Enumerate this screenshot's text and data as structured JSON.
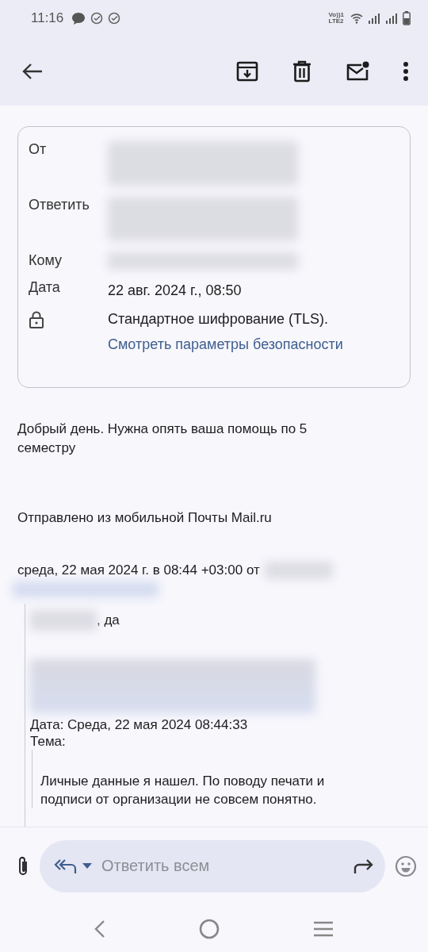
{
  "status_bar": {
    "time": "11:16",
    "volte_top": "Vo))1",
    "volte_bottom": "LTE2"
  },
  "header": {
    "rows": [
      {
        "label": "От",
        "kind": "blurred_block"
      },
      {
        "label": "Ответить",
        "kind": "blurred_block"
      },
      {
        "label": "Кому",
        "kind": "blurred_line"
      },
      {
        "label": "Дата",
        "kind": "text",
        "value": "22 авг. 2024 г., 08:50"
      }
    ],
    "security": {
      "text": "Стандартное шифрование (TLS).",
      "link": "Смотреть параметры безопасности"
    }
  },
  "body": [
    {
      "kind": "text",
      "text": "Добрый день. Нужна опять ваша помощь по 5 семестру"
    },
    {
      "kind": "text",
      "text": "Отправлено из мобильной Почты Mail.ru"
    },
    {
      "kind": "attribution",
      "text": "среда, 22 мая 2024 г. в 08:44 +03:00 от",
      "blurred": true
    },
    {
      "kind": "blurred_link"
    },
    {
      "kind": "quote",
      "children": [
        {
          "kind": "greeting",
          "text": ", да",
          "blurred": true
        },
        {
          "kind": "blurred_block"
        },
        {
          "kind": "line",
          "text": "Дата: Среда, 22 мая 2024 08:44:33"
        },
        {
          "kind": "line",
          "text": "Тема:"
        },
        {
          "kind": "quote",
          "children": [
            {
              "kind": "text",
              "text": "Личные данные я нашел. По поводу печати и подписи от организации не совсем понятно."
            }
          ]
        }
      ]
    }
  ],
  "compose": {
    "placeholder": "Ответить всем"
  }
}
